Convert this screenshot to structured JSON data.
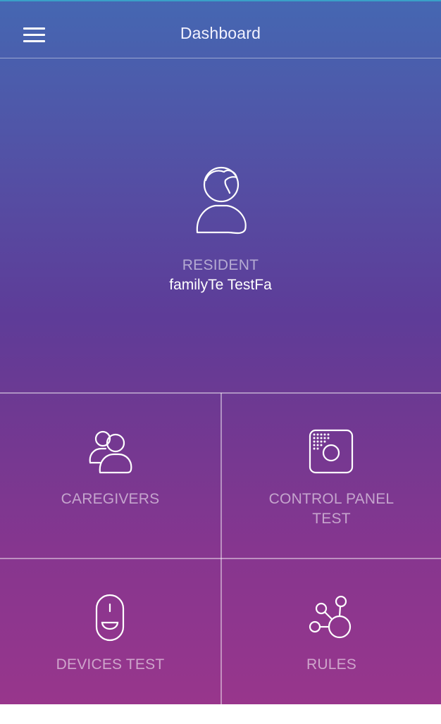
{
  "header": {
    "title": "Dashboard",
    "menu_icon": "hamburger-menu-icon"
  },
  "resident": {
    "label": "RESIDENT",
    "name": "familyTe TestFa",
    "icon": "person-icon"
  },
  "tiles": {
    "caregivers": {
      "label": "CAREGIVERS",
      "icon": "caregivers-icon"
    },
    "control_panel": {
      "label_line1": "CONTROL PANEL",
      "label_line2": "TEST",
      "icon": "control-panel-icon"
    },
    "devices": {
      "label": "DEVICES TEST",
      "icon": "device-sensor-icon"
    },
    "rules": {
      "label": "RULES",
      "icon": "rules-network-icon"
    }
  },
  "colors": {
    "gradient_top": "#4567b2",
    "gradient_mid": "#5e3c98",
    "gradient_bottom": "#98368c",
    "accent_line": "#3aa0c8"
  }
}
